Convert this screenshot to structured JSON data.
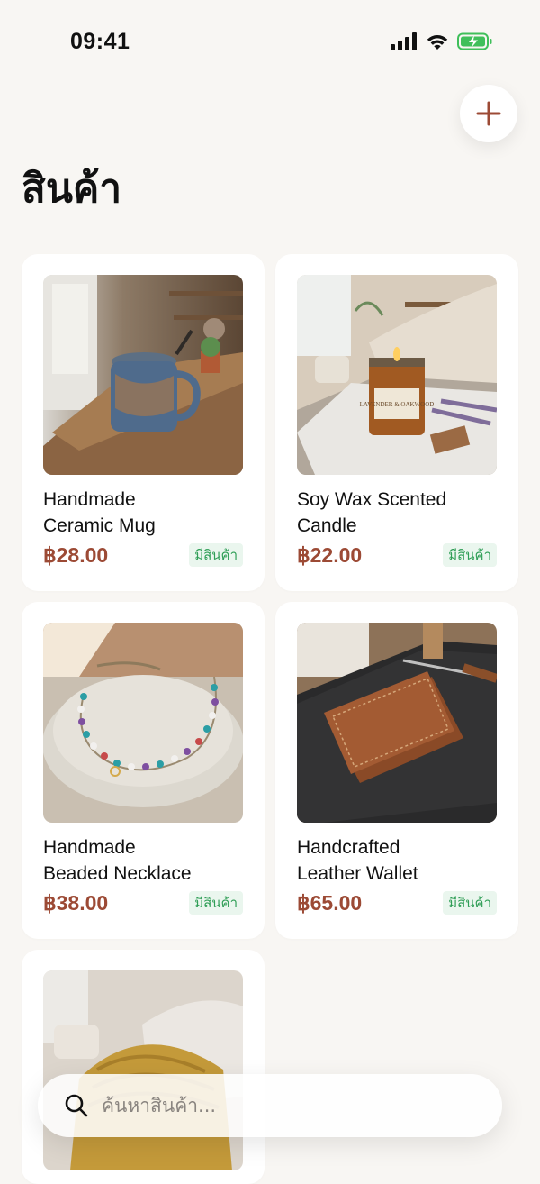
{
  "status_bar": {
    "time": "09:41"
  },
  "header": {
    "title": "สินค้า",
    "add_icon": "plus-icon"
  },
  "products": [
    {
      "name_line1": "Handmade",
      "name_line2": "Ceramic Mug",
      "price": "฿28.00",
      "stock": "มีสินค้า"
    },
    {
      "name_line1": "Soy Wax Scented",
      "name_line2": "Candle",
      "price": "฿22.00",
      "stock": "มีสินค้า",
      "image_label": "LAVENDER & OAKWOOD"
    },
    {
      "name_line1": "Handmade",
      "name_line2": "Beaded Necklace",
      "price": "฿38.00",
      "stock": "มีสินค้า"
    },
    {
      "name_line1": "Handcrafted",
      "name_line2": "Leather Wallet",
      "price": "฿65.00",
      "stock": "มีสินค้า"
    }
  ],
  "search": {
    "placeholder": "ค้นหาสินค้า...",
    "icon": "search-icon"
  },
  "colors": {
    "price": "#9c4a35",
    "stock_text": "#2f9e56",
    "stock_bg": "#eaf6ee",
    "accent": "#9c4a35",
    "background": "#f8f6f3"
  }
}
